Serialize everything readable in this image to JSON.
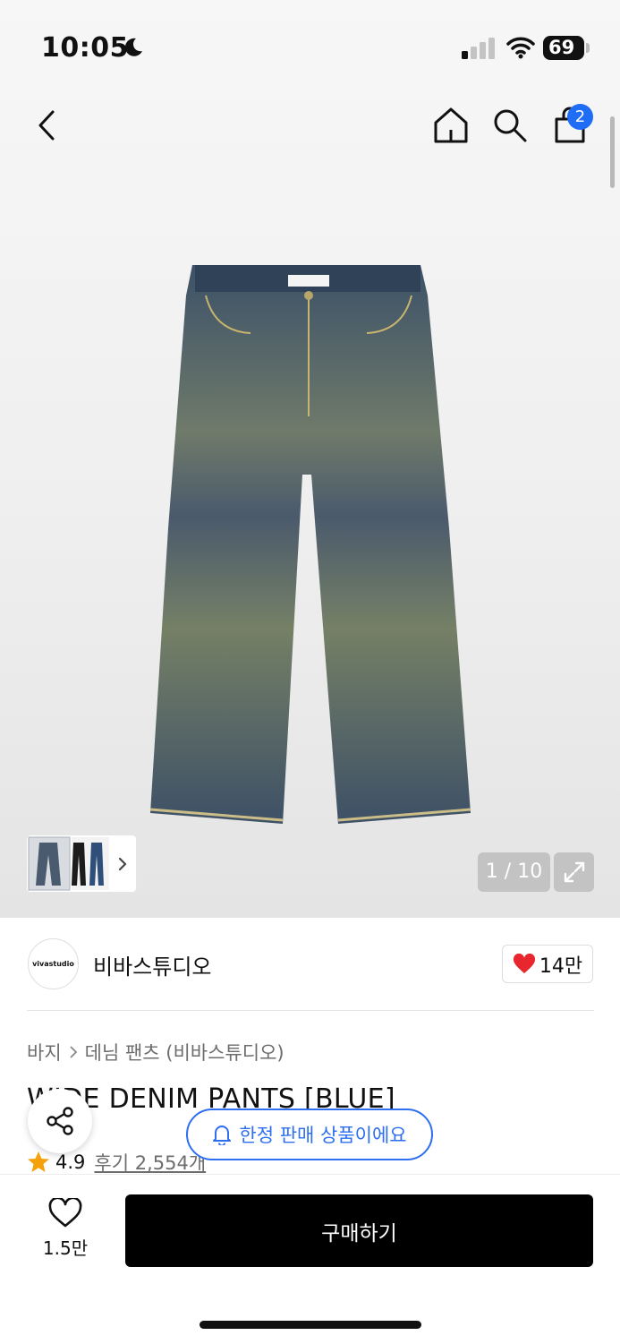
{
  "status": {
    "time": "10:05",
    "battery": "69"
  },
  "header": {
    "cart_count": "2"
  },
  "gallery": {
    "counter": "1 / 10"
  },
  "brand": {
    "logo_text": "vivastudio",
    "name": "비바스튜디오",
    "likes": "14만"
  },
  "product": {
    "breadcrumb": [
      "바지",
      "데님 팬츠 (비바스튜디오)"
    ],
    "title": "WIDE DENIM PANTS [BLUE]",
    "rating": "4.9",
    "reviews": "후기 2,554개"
  },
  "toast": {
    "text": "한정 판매 상품이에요"
  },
  "bottom": {
    "wish_count": "1.5만",
    "buy_label": "구매하기"
  },
  "colors": {
    "accent_blue": "#2d6ff0",
    "heart_red": "#e8262e",
    "star": "#f5a10b"
  }
}
